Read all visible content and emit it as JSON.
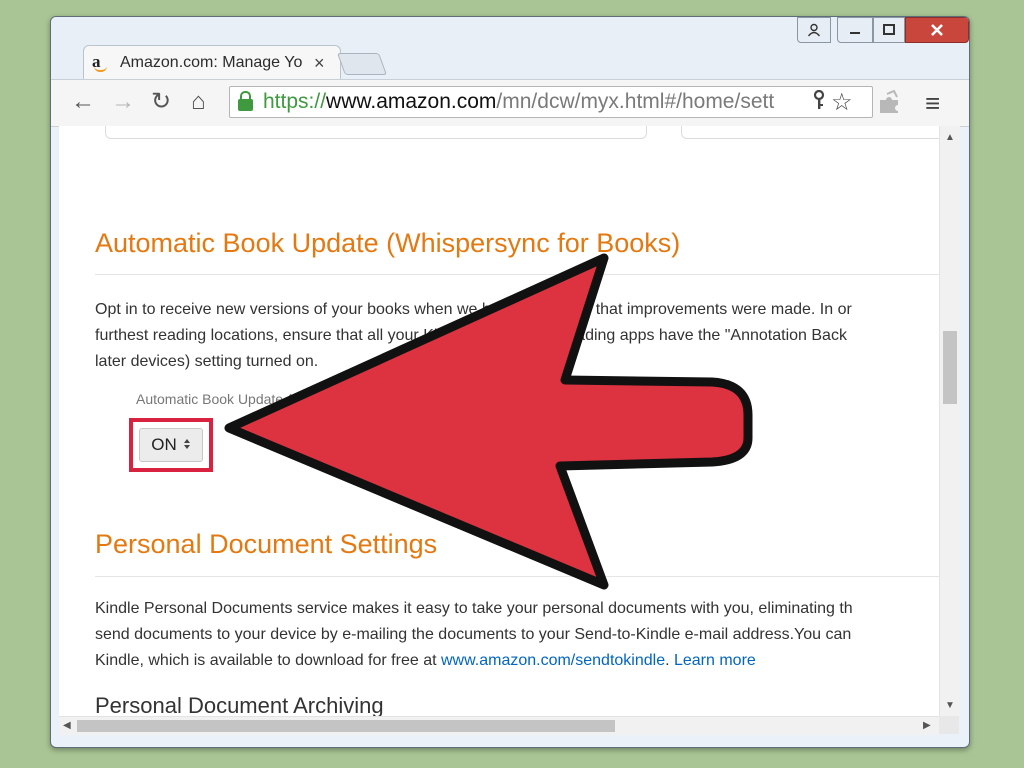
{
  "browser": {
    "tab": {
      "title": "Amazon.com: Manage Yo",
      "favicon": "amazon-logo-icon",
      "close_icon": "×"
    },
    "window_controls": {
      "user": "user-icon",
      "minimize": "minimize-icon",
      "maximize": "maximize-icon",
      "close": "close-icon"
    },
    "toolbar": {
      "back": "←",
      "forward": "→",
      "reload": "↻",
      "home": "⌂",
      "url_scheme": "https://",
      "url_host": "www.amazon.com",
      "url_path": "/mn/dcw/myx.html#/home/sett",
      "key_icon": "key-icon",
      "star_icon": "☆",
      "extension_icon": "puzzle-icon",
      "menu_icon": "≡"
    }
  },
  "page": {
    "whispersync": {
      "heading": "Automatic Book Update (Whispersync for Books)",
      "lines": [
        "Opt in to receive new versions of your books when we have confirmed that improvements were made. In or",
        "furthest reading locations, ensure that all your Kindle devices and reading apps have the \"Annotation Back",
        "later devices) setting turned on."
      ],
      "field_label": "Automatic Book Update (W",
      "select_value": "ON",
      "select_arrow": "▲▼"
    },
    "personal_docs": {
      "heading": "Personal Document Settings",
      "lines": [
        "Kindle Personal Documents service makes it easy to take your personal documents with you, eliminating th",
        "send documents to your device by e-mailing the documents to your Send-to-Kindle e-mail address.You can"
      ],
      "line3_prefix": "Kindle, which is available to download for free at ",
      "link_sendtokindle": "www.amazon.com/sendtokindle",
      "period": ". ",
      "link_learn_more": "Learn more",
      "archiving_heading": "Personal Document Archiving"
    }
  },
  "colors": {
    "heading_orange": "#e47911",
    "link_blue": "#0066c0",
    "arrow_red": "#dd3340",
    "highlight_red": "#d9223f",
    "background_green": "#a9c595"
  }
}
